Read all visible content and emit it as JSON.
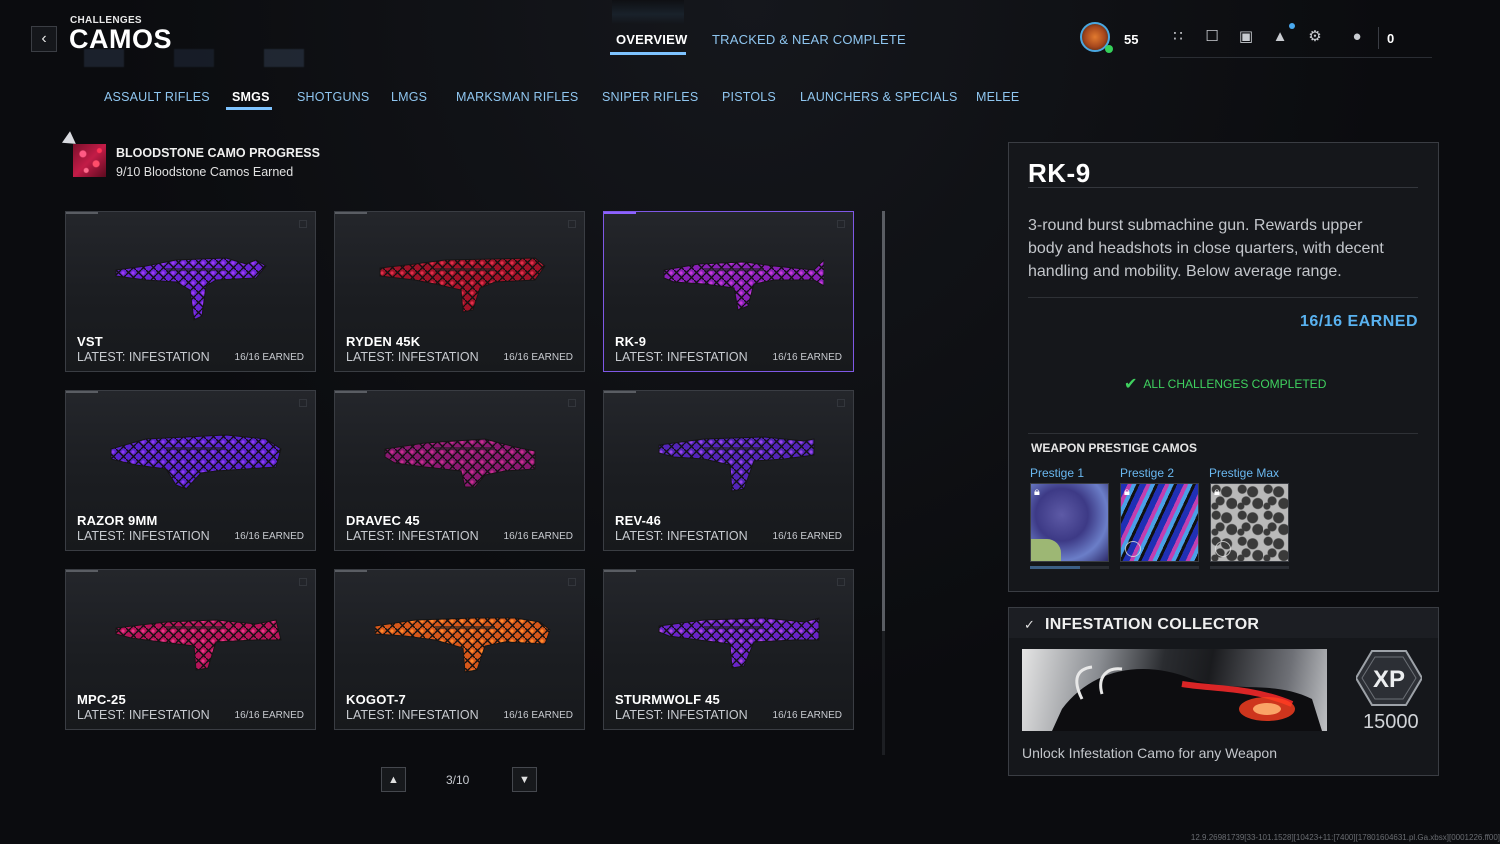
{
  "header": {
    "eyebrow": "CHALLENGES",
    "title": "CAMOS",
    "tabs": [
      {
        "label": "OVERVIEW",
        "active": true
      },
      {
        "label": "TRACKED & NEAR COMPLETE",
        "active": false
      }
    ],
    "level": "55",
    "count": "0"
  },
  "categories": [
    {
      "label": "ASSAULT RIFLES",
      "active": false
    },
    {
      "label": "SMGS",
      "active": true
    },
    {
      "label": "SHOTGUNS",
      "active": false
    },
    {
      "label": "LMGS",
      "active": false
    },
    {
      "label": "MARKSMAN RIFLES",
      "active": false
    },
    {
      "label": "SNIPER RIFLES",
      "active": false
    },
    {
      "label": "PISTOLS",
      "active": false
    },
    {
      "label": "LAUNCHERS & SPECIALS",
      "active": false
    },
    {
      "label": "MELEE",
      "active": false
    }
  ],
  "progress": {
    "title": "BLOODSTONE CAMO PROGRESS",
    "subtitle": "9/10 Bloodstone Camos Earned"
  },
  "weapons": [
    {
      "name": "VST",
      "latest": "LATEST: INFESTATION",
      "earned": "16/16 EARNED",
      "selected": false,
      "colors": [
        "#6a24d6",
        "#9b3cf2"
      ]
    },
    {
      "name": "RYDEN 45K",
      "latest": "LATEST: INFESTATION",
      "earned": "16/16 EARNED",
      "selected": false,
      "colors": [
        "#a01228",
        "#e0304a"
      ]
    },
    {
      "name": "RK-9",
      "latest": "LATEST: INFESTATION",
      "earned": "16/16 EARNED",
      "selected": true,
      "colors": [
        "#8a1fb8",
        "#c53cd8"
      ]
    },
    {
      "name": "RAZOR 9MM",
      "latest": "LATEST: INFESTATION",
      "earned": "16/16 EARNED",
      "selected": false,
      "colors": [
        "#5a22d0",
        "#8d3cf0"
      ]
    },
    {
      "name": "DRAVEC 45",
      "latest": "LATEST: INFESTATION",
      "earned": "16/16 EARNED",
      "selected": false,
      "colors": [
        "#8a1870",
        "#c8308f"
      ]
    },
    {
      "name": "REV-46",
      "latest": "LATEST: INFESTATION",
      "earned": "16/16 EARNED",
      "selected": false,
      "colors": [
        "#5324b8",
        "#9a48e8"
      ]
    },
    {
      "name": "MPC-25",
      "latest": "LATEST: INFESTATION",
      "earned": "16/16 EARNED",
      "selected": false,
      "colors": [
        "#b8145a",
        "#e83a8a"
      ]
    },
    {
      "name": "KOGOT-7",
      "latest": "LATEST: INFESTATION",
      "earned": "16/16 EARNED",
      "selected": false,
      "colors": [
        "#d8581a",
        "#ff8a2e"
      ]
    },
    {
      "name": "STURMWOLF 45",
      "latest": "LATEST: INFESTATION",
      "earned": "16/16 EARNED",
      "selected": false,
      "colors": [
        "#6a24c8",
        "#b04ae0"
      ]
    }
  ],
  "pagination": {
    "text": "3/10"
  },
  "detail": {
    "name": "RK-9",
    "description": "3-round burst submachine gun. Rewards upper body and headshots in close quarters, with decent handling and mobility. Below average range.",
    "earned": "16/16 EARNED",
    "complete": "ALL CHALLENGES COMPLETED",
    "prestige_title": "WEAPON PRESTIGE CAMOS",
    "prestige": [
      {
        "label": "Prestige 1"
      },
      {
        "label": "Prestige 2"
      },
      {
        "label": "Prestige Max"
      }
    ]
  },
  "challenge": {
    "title": "INFESTATION COLLECTOR",
    "xp_label": "XP",
    "xp_amount": "15000",
    "description": "Unlock Infestation Camo for any Weapon"
  },
  "footer": "12.9.26981739[33-101.1528][10423+11:[7400][17801604631.pl.Ga.xbsx][0001226.ff00]",
  "colors": {
    "accent_blue": "#7ec3ff",
    "tab_text": "#8fc6f0",
    "complete_green": "#3fd15f",
    "selected_border": "#7f58e6"
  }
}
